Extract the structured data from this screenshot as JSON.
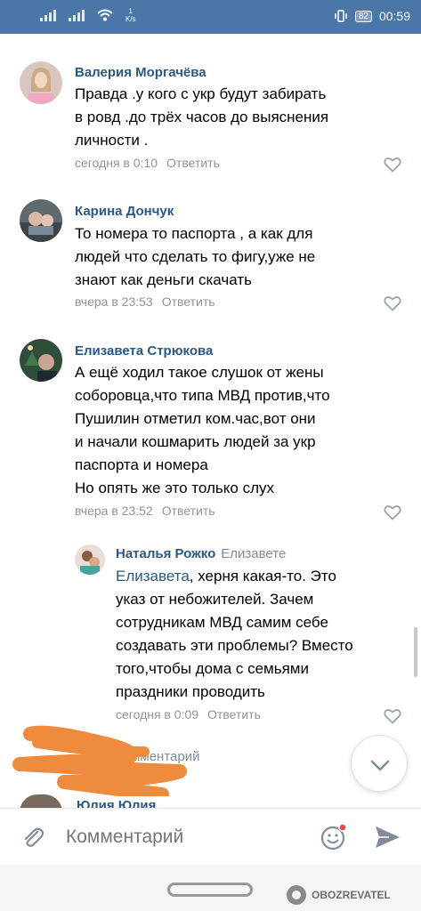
{
  "status_bar": {
    "speed_value": "1",
    "speed_unit": "K/s",
    "battery": "82",
    "time": "00:59"
  },
  "comments": [
    {
      "author": "Валерия Моргачёва",
      "text": "Правда .у кого с укр будут забирать\nв ровд .до трёх часов до выяснения\nличности .",
      "time": "сегодня в 0:10",
      "reply": "Ответить"
    },
    {
      "author": "Карина Дончук",
      "text": "То номера то паспорта , а как для\nлюдей что сделать то фигу,уже не\nзнают как деньги скачать",
      "time": "вчера в 23:53",
      "reply": "Ответить"
    },
    {
      "author": "Елизавета Стрюкова",
      "text": "А ещё ходил такое слушок от жены\nсоборовца,что типа МВД против,что\nПушилин отметил ком.час,вот они\nи начали кошмарить людей за укр\nпаспорта и номера\nНо опять же это только слух",
      "time": "вчера в 23:52",
      "reply": "Ответить"
    }
  ],
  "reply_comment": {
    "author": "Наталья Рожко",
    "reply_to": "Елизавете",
    "mention": "Елизавета",
    "text": ", херня какая-то. Это\nуказ от небожителей. Зачем\nсотрудникам МВД самим себе\nсоздавать эти проблемы? Вместо\nтого,чтобы дома с семьями\nпраздники проводить",
    "time": "сегодня в 0:09",
    "reply": "Ответить"
  },
  "ghost_comment_label": "Комментарий",
  "next_comment_author": "Юлия Юлия",
  "composer": {
    "placeholder": "Комментарий"
  },
  "watermark": "OBOZREVATEL",
  "colors": {
    "accent": "#4a76a8",
    "link": "#2a5885",
    "meta": "#939393",
    "scribble": "#f08a3c"
  },
  "icons": [
    "signal-icon",
    "wifi-icon",
    "vibrate-icon",
    "battery-icon",
    "heart-icon",
    "chevron-down-icon",
    "paperclip-icon",
    "smile-icon",
    "send-icon"
  ]
}
